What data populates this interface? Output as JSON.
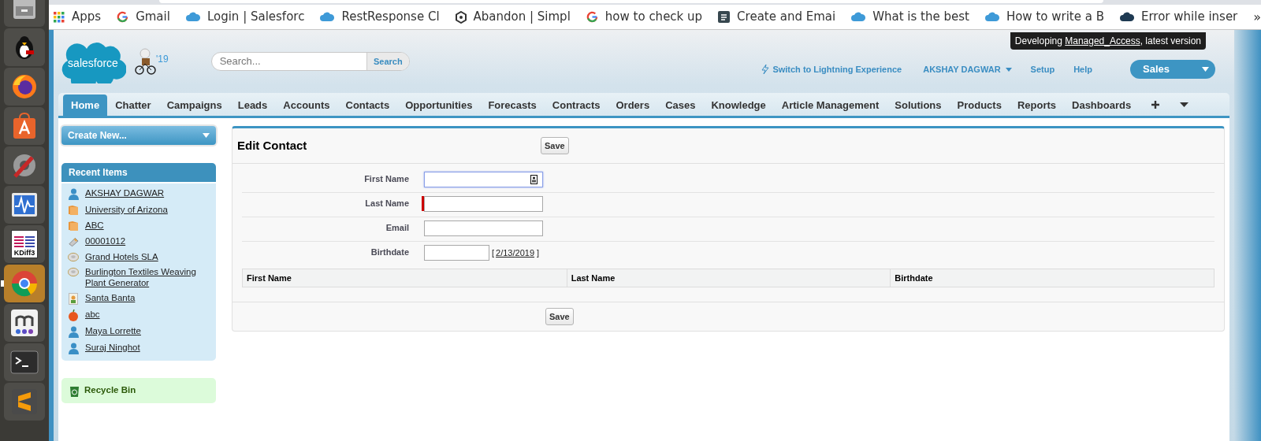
{
  "dock": [
    {
      "kind": "drawer",
      "selected": false
    },
    {
      "kind": "penguin",
      "selected": false
    },
    {
      "kind": "firefox",
      "selected": false
    },
    {
      "kind": "store",
      "selected": false
    },
    {
      "kind": "settings",
      "selected": false
    },
    {
      "kind": "monitor",
      "selected": false
    },
    {
      "kind": "kdiff",
      "label": "KDiff3",
      "selected": false
    },
    {
      "kind": "chrome",
      "selected": true
    },
    {
      "kind": "m",
      "selected": false
    },
    {
      "kind": "terminal",
      "selected": false
    },
    {
      "kind": "sublime",
      "selected": false
    }
  ],
  "bookmarks": [
    {
      "kind": "apps",
      "label": "Apps"
    },
    {
      "kind": "google",
      "label": "Gmail"
    },
    {
      "kind": "cloud",
      "label": "Login | Salesforc"
    },
    {
      "kind": "cloud",
      "label": "RestResponse Cl"
    },
    {
      "kind": "hex",
      "label": "Abandon | Simpl"
    },
    {
      "kind": "google",
      "label": "how to check up"
    },
    {
      "kind": "doc",
      "label": "Create and Emai"
    },
    {
      "kind": "cloud",
      "label": "What is the best"
    },
    {
      "kind": "cloud",
      "label": "How to write a B"
    },
    {
      "kind": "darkcloud",
      "label": "Error while inser"
    }
  ],
  "bookmarks_more": "»",
  "tooltip": {
    "before": "Developing ",
    "link": "Managed_Access",
    "after": ", latest version"
  },
  "header": {
    "logo": "salesforce",
    "release": "'19",
    "search": {
      "placeholder": "Search...",
      "button": "Search"
    },
    "lightning_link": "Switch to Lightning Experience",
    "user": "AKSHAY DAGWAR",
    "links": [
      "Setup",
      "Help"
    ],
    "app": "Sales"
  },
  "tabs": [
    {
      "label": "Home",
      "selected": true
    },
    {
      "label": "Chatter",
      "selected": false
    },
    {
      "label": "Campaigns",
      "selected": false
    },
    {
      "label": "Leads",
      "selected": false
    },
    {
      "label": "Accounts",
      "selected": false
    },
    {
      "label": "Contacts",
      "selected": false
    },
    {
      "label": "Opportunities",
      "selected": false
    },
    {
      "label": "Forecasts",
      "selected": false
    },
    {
      "label": "Contracts",
      "selected": false
    },
    {
      "label": "Orders",
      "selected": false
    },
    {
      "label": "Cases",
      "selected": false
    },
    {
      "label": "Knowledge",
      "selected": false
    },
    {
      "label": "Article Management",
      "selected": false
    },
    {
      "label": "Solutions",
      "selected": false
    },
    {
      "label": "Products",
      "selected": false
    },
    {
      "label": "Reports",
      "selected": false
    },
    {
      "label": "Dashboards",
      "selected": false
    }
  ],
  "sidebar": {
    "create_new": "Create New...",
    "recent_title": "Recent Items",
    "recent_items": [
      {
        "kind": "person",
        "label": "AKSHAY DAGWAR"
      },
      {
        "kind": "account",
        "label": "University of Arizona"
      },
      {
        "kind": "account",
        "label": "ABC"
      },
      {
        "kind": "contract",
        "label": "00001012"
      },
      {
        "kind": "sla",
        "label": "Grand Hotels SLA"
      },
      {
        "kind": "sla",
        "label": "Burlington Textiles Weaving Plant Generator"
      },
      {
        "kind": "lead",
        "label": "Santa Banta"
      },
      {
        "kind": "opportunity",
        "label": "abc"
      },
      {
        "kind": "person",
        "label": "Maya Lorrette"
      },
      {
        "kind": "person",
        "label": "Suraj Ninghot"
      }
    ],
    "recycle_bin": "Recycle Bin"
  },
  "form": {
    "title": "Edit Contact",
    "save": "Save",
    "fields": [
      {
        "kind": "text",
        "label": "First Name",
        "required": false,
        "focused": true
      },
      {
        "kind": "text",
        "label": "Last Name",
        "required": true,
        "focused": false
      },
      {
        "kind": "text",
        "label": "Email",
        "required": false,
        "focused": false
      },
      {
        "kind": "date",
        "label": "Birthdate",
        "required": false,
        "focused": false,
        "today": "2/13/2019",
        "open_bracket": "[",
        "close_bracket": "]"
      }
    ],
    "table": {
      "columns": [
        "First Name",
        "Last Name",
        "Birthdate"
      ]
    },
    "save_bottom": "Save"
  }
}
